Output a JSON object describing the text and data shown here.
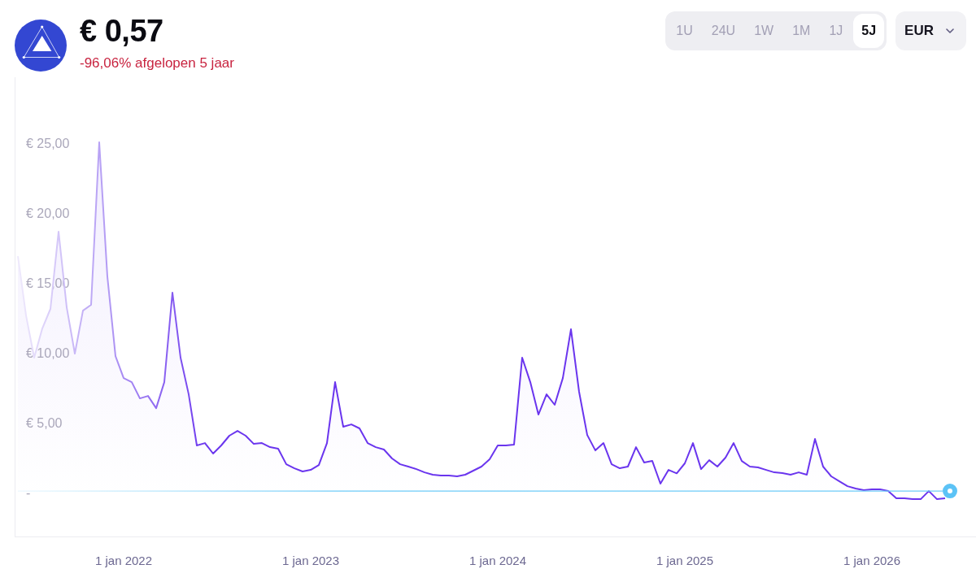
{
  "asset": {
    "price": "€ 0,57",
    "change": "-96,06% afgelopen 5 jaar"
  },
  "timeframes": [
    {
      "label": "1U",
      "selected": false
    },
    {
      "label": "24U",
      "selected": false
    },
    {
      "label": "1W",
      "selected": false
    },
    {
      "label": "1M",
      "selected": false
    },
    {
      "label": "1J",
      "selected": false
    },
    {
      "label": "5J",
      "selected": true
    }
  ],
  "currency": {
    "value": "EUR"
  },
  "chart": {
    "chart_data": {
      "type": "area",
      "categories": [
        null,
        null,
        null,
        null,
        null,
        null,
        null,
        null,
        null,
        null,
        null,
        null,
        null,
        "1 jan 2022",
        null,
        null,
        null,
        null,
        null,
        null,
        null,
        null,
        null,
        null,
        null,
        null,
        null,
        null,
        null,
        null,
        null,
        null,
        null,
        null,
        null,
        null,
        "1 jan 2023",
        null,
        null,
        null,
        null,
        null,
        null,
        null,
        null,
        null,
        null,
        null,
        null,
        null,
        null,
        null,
        null,
        null,
        null,
        null,
        null,
        null,
        null,
        "1 jan 2024",
        null,
        null,
        null,
        null,
        null,
        null,
        null,
        null,
        null,
        null,
        null,
        null,
        null,
        null,
        null,
        null,
        null,
        null,
        null,
        null,
        null,
        null,
        "1 jan 2025",
        null,
        null,
        null,
        null,
        null,
        null,
        null,
        null,
        null,
        null,
        null,
        null,
        null,
        null,
        null,
        null,
        null,
        null,
        null,
        null,
        null,
        null,
        "1 jan 2026",
        null,
        null,
        null,
        null,
        null,
        null,
        null,
        null,
        null
      ],
      "values": [
        17.03,
        12.79,
        9.77,
        11.86,
        13.26,
        18.78,
        13.37,
        10.06,
        13.14,
        13.55,
        25.17,
        15.58,
        9.88,
        8.31,
        8.02,
        6.86,
        7.03,
        6.16,
        8.02,
        14.42,
        9.77,
        7.15,
        3.49,
        3.66,
        2.91,
        3.49,
        4.19,
        4.53,
        4.19,
        3.6,
        3.66,
        3.37,
        3.26,
        2.15,
        1.86,
        1.63,
        1.74,
        2.09,
        3.66,
        8.02,
        4.83,
        5.0,
        4.71,
        3.66,
        3.37,
        3.2,
        2.56,
        2.15,
        1.98,
        1.8,
        1.57,
        1.4,
        1.34,
        1.34,
        1.28,
        1.4,
        1.69,
        1.98,
        2.5,
        3.49,
        3.49,
        3.55,
        9.77,
        8.02,
        5.7,
        7.15,
        6.4,
        8.31,
        11.8,
        7.33,
        4.24,
        3.14,
        3.66,
        2.15,
        1.86,
        1.98,
        3.37,
        2.27,
        2.38,
        0.76,
        1.74,
        1.5,
        2.21,
        3.66,
        1.8,
        2.44,
        1.98,
        2.62,
        3.66,
        2.38,
        1.98,
        1.92,
        1.74,
        1.57,
        1.51,
        1.4,
        1.57,
        1.4,
        3.95,
        1.98,
        1.28,
        0.93,
        0.58,
        0.41,
        0.29,
        0.35,
        0.35,
        0.23,
        -0.29,
        -0.29,
        -0.35,
        -0.35,
        0.23,
        -0.35,
        -0.29
      ],
      "ylim": [
        -3.02,
        29.83
      ],
      "yticks": [
        {
          "value": 0,
          "label": "-"
        },
        {
          "value": 5,
          "label": "€ 5,00"
        },
        {
          "value": 10,
          "label": "€ 10,00"
        },
        {
          "value": 15,
          "label": "€ 15,00"
        },
        {
          "value": 20,
          "label": "€ 20,00"
        },
        {
          "value": 25,
          "label": "€ 25,00"
        }
      ],
      "ref_lines": [
        {
          "axis": "y",
          "value": 0.23
        }
      ]
    }
  }
}
